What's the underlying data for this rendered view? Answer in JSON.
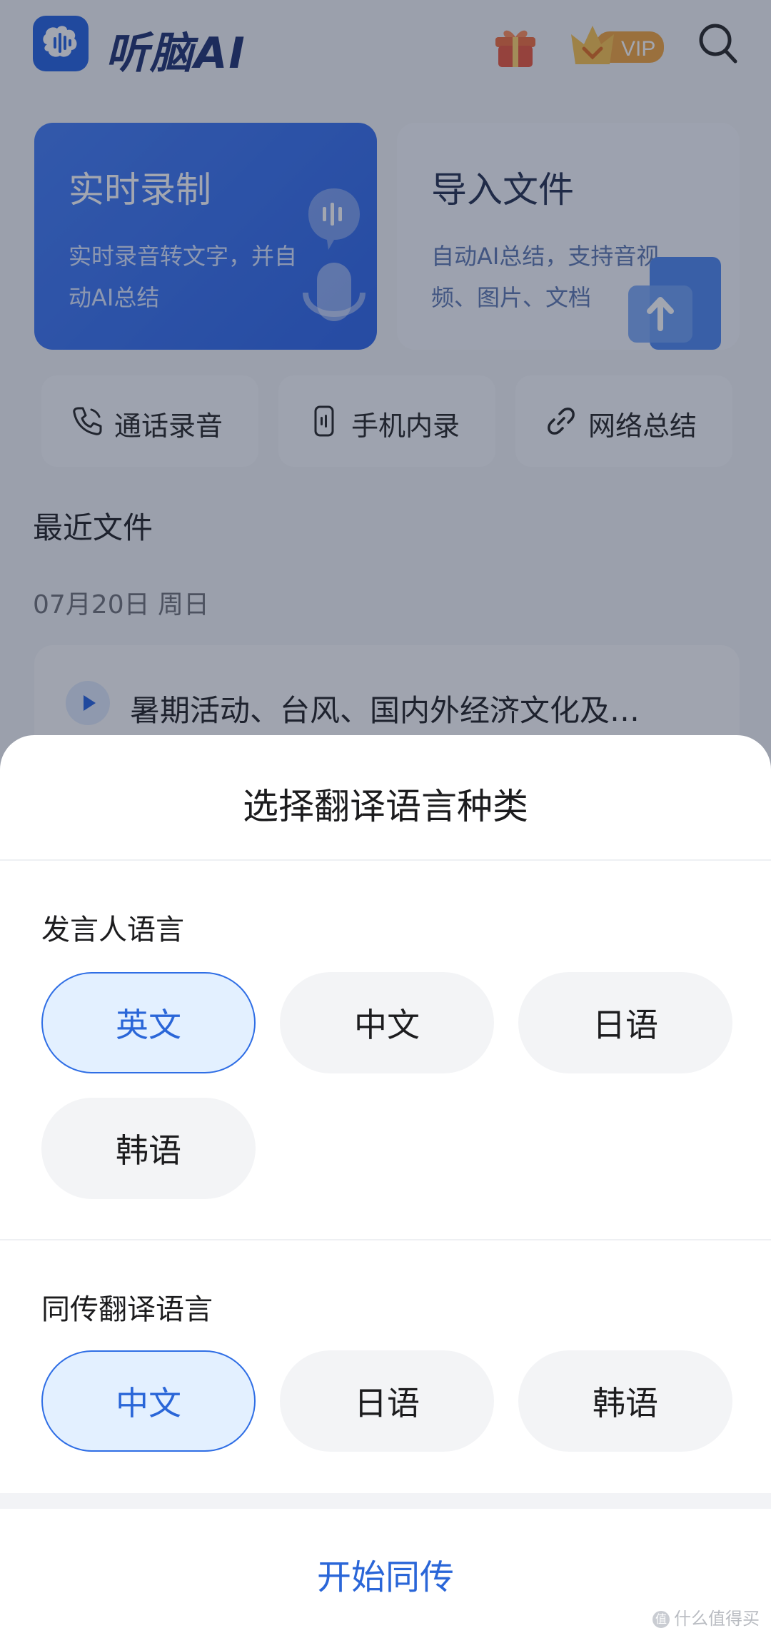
{
  "header": {
    "brand": "听脑AI",
    "vip_label": "VIP"
  },
  "cards": {
    "record": {
      "title": "实时录制",
      "desc": "实时录音转文字，并自动AI总结"
    },
    "import": {
      "title": "导入文件",
      "desc": "自动AI总结，支持音视频、图片、文档"
    }
  },
  "quick_actions": [
    {
      "label": "通话录音",
      "icon": "phone-icon"
    },
    {
      "label": "手机内录",
      "icon": "mobile-icon"
    },
    {
      "label": "网络总结",
      "icon": "link-icon"
    }
  ],
  "recent": {
    "title": "最近文件",
    "date": "07月20日 周日",
    "files": [
      {
        "title": "暑期活动、台风、国内外经济文化及…"
      }
    ]
  },
  "sheet": {
    "title": "选择翻译语言种类",
    "speaker": {
      "label": "发言人语言",
      "options": [
        "英文",
        "中文",
        "日语",
        "韩语"
      ],
      "selected": "英文"
    },
    "target": {
      "label": "同传翻译语言",
      "options": [
        "中文",
        "日语",
        "韩语"
      ],
      "selected": "中文"
    },
    "start_label": "开始同传"
  },
  "colors": {
    "accent": "#2a66d8",
    "brand_blue": "#1f5fe0",
    "selected_bg": "#e3f0ff"
  },
  "watermark": "什么值得买"
}
